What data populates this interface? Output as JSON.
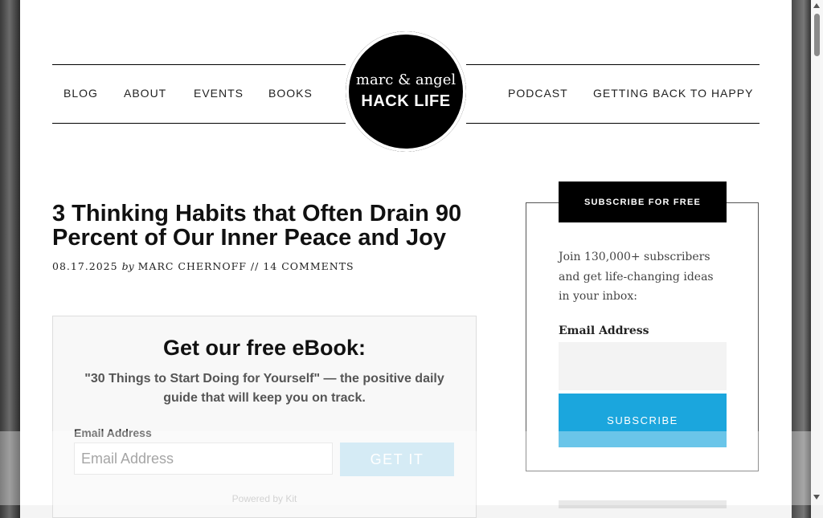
{
  "nav": {
    "items_left": [
      "BLOG",
      "ABOUT",
      "EVENTS",
      "BOOKS"
    ],
    "items_right": [
      "PODCAST",
      "GETTING BACK TO HAPPY"
    ]
  },
  "logo": {
    "line1": "marc & angel",
    "line2": "HACK LIFE"
  },
  "article": {
    "title": "3 Thinking Habits that Often Drain 90 Percent of Our Inner Peace and Joy",
    "date": "08.17.2025",
    "by": "by",
    "author": "MARC CHERNOFF",
    "separator": "//",
    "comments": "14 COMMENTS"
  },
  "ebook": {
    "heading": "Get our free eBook:",
    "subtitle": "\"30 Things to Start Doing for Yourself\" — the positive daily guide that will keep you on track.",
    "email_label": "Email Address",
    "email_placeholder": "Email Address",
    "button": "GET IT",
    "powered": "Powered by Kit"
  },
  "sidebar": {
    "title": "SUBSCRIBE FOR FREE",
    "text": "Join 130,000+ subscribers and get life-changing ideas in your inbox:",
    "email_label": "Email Address",
    "button": "SUBSCRIBE"
  },
  "colors": {
    "accent": "#1ba6dd",
    "ebook_button": "#bfe0f0",
    "black": "#000000"
  }
}
